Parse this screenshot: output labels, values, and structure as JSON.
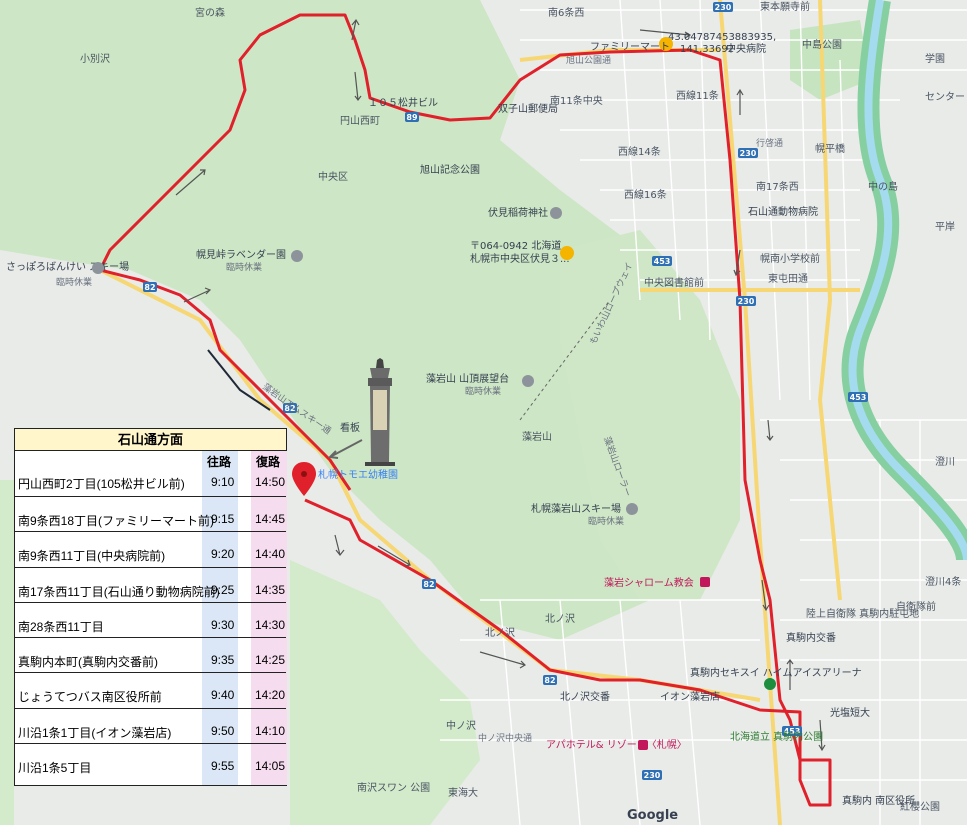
{
  "map": {
    "labels": {
      "miyanomori": "宮の森",
      "kobetsuzawa": "小別沢",
      "maruyama_nishimachi": "円山西町",
      "chuo_ku": "中央区",
      "asahiyama_park": "旭山記念公園",
      "fushimi_inari": "伏見稲荷神社",
      "address_line1": "〒064-0942 北海道",
      "address_line2": "札幌市中央区伏見３...",
      "moiwa_summit": "藻岩山 山頂展望台",
      "moiwa_summit_sub": "臨時休業",
      "moiwayama": "藻岩山",
      "moiwa_ski": "札幌藻岩山スキー場",
      "moiwa_ski_sub": "臨時休業",
      "moiwa_ropeway": "もいわ山ロープウェイ",
      "bankei_ski": "さっぽろばんけい\nスキー場",
      "bankei_ski_sub": "臨時休業",
      "lavender_garden": "幌見峠ラベンダー園",
      "lavender_garden_sub": "臨時休業",
      "kindergarten": "札幌トモエ幼稚園",
      "signboard": "看板",
      "coords": "43.04787453883935,",
      "coords2": "141.33692",
      "chuo_hospital": "中央病院",
      "family_mart": "ファミリーマート",
      "matsui_bldg": "１０５松井ビル",
      "futago_post": "双子山郵便局",
      "asahiyama_koen_dori": "旭山公園通",
      "s6": "南6条西",
      "s11": "南11条中央",
      "w11": "西線11条",
      "w14": "西線14条",
      "w16": "西線16条",
      "higashi_honganji": "東本願寺前",
      "nakajima_park": "中島公園",
      "horohira_bridge": "幌平橋",
      "nakanoshima": "中の島",
      "s17w": "南17条西",
      "ishiyama_hospital": "石山通動物病院",
      "gakuin": "学園",
      "center": "センター",
      "hiragishi": "平岸",
      "konan_school": "幌南小学校前",
      "higashi_tonden": "東屯田通",
      "chuo_library": "中央図書館前",
      "gyoshin": "行啓通",
      "sumikawa": "澄川",
      "sumikawa4": "澄川4条",
      "jieitai": "自衛隊前",
      "rikujo_jieitai": "陸上自衛隊\n真駒内駐屯地",
      "makomanai_koban": "真駒内交番",
      "sekisui_arena": "真駒内セキスイ\nハイムアイスアリーナ",
      "aeon_moiwa": "イオン藻岩店",
      "makomanai_park": "北海道立\n真駒内公園",
      "koen_tanki": "光塩短大",
      "minami_ku": "真駒内\n南区役所",
      "beni_sakura": "紅櫻公園",
      "fujino_church": "藻岩シャローム教会",
      "kita_no_sawa": "北ノ沢",
      "kita_no_sawa2": "北ノ沢",
      "kita_no_sawa_koban": "北ノ沢交番",
      "naka_no_sawa": "中ノ沢",
      "chuo_naka": "中ノ沢中央通",
      "apa_hotel": "アパホテル&\nリゾート〈札幌〉",
      "tokai_univ": "東海大",
      "minamisawa": "南沢スワン\n公園",
      "google": "Google",
      "route_kami_kiroshi": "藻岩山ローラー",
      "route_82": "82",
      "route_89": "89",
      "route_230": "230",
      "route_453": "453",
      "mountain_road": "藻岩山エムスキー通"
    },
    "colors": {
      "route": "#e0202a",
      "road_major": "#f2c94c",
      "green_area": "#cfe9c9",
      "forest": "#bfe0b6",
      "water": "#9fd3e8",
      "river": "#8fd1a0"
    }
  },
  "timetable": {
    "title": "石山通方面",
    "out_label": "往路",
    "ret_label": "復路",
    "rows": [
      {
        "stop": "円山西町2丁目(105松井ビル前)",
        "out": "9:10",
        "ret": "14:50"
      },
      {
        "stop": "南9条西18丁目(ファミリーマート前)",
        "out": "9:15",
        "ret": "14:45"
      },
      {
        "stop": "南9条西11丁目(中央病院前)",
        "out": "9:20",
        "ret": "14:40"
      },
      {
        "stop": "南17条西11丁目(石山通り動物病院前)",
        "out": "9:25",
        "ret": "14:35"
      },
      {
        "stop": "南28条西11丁目",
        "out": "9:30",
        "ret": "14:30"
      },
      {
        "stop": "真駒内本町(真駒内交番前)",
        "out": "9:35",
        "ret": "14:25"
      },
      {
        "stop": "じょうてつバス南区役所前",
        "out": "9:40",
        "ret": "14:20"
      },
      {
        "stop": "川沿1条1丁目(イオン藻岩店)",
        "out": "9:50",
        "ret": "14:10"
      },
      {
        "stop": "川沿1条5丁目",
        "out": "9:55",
        "ret": "14:05"
      }
    ]
  }
}
